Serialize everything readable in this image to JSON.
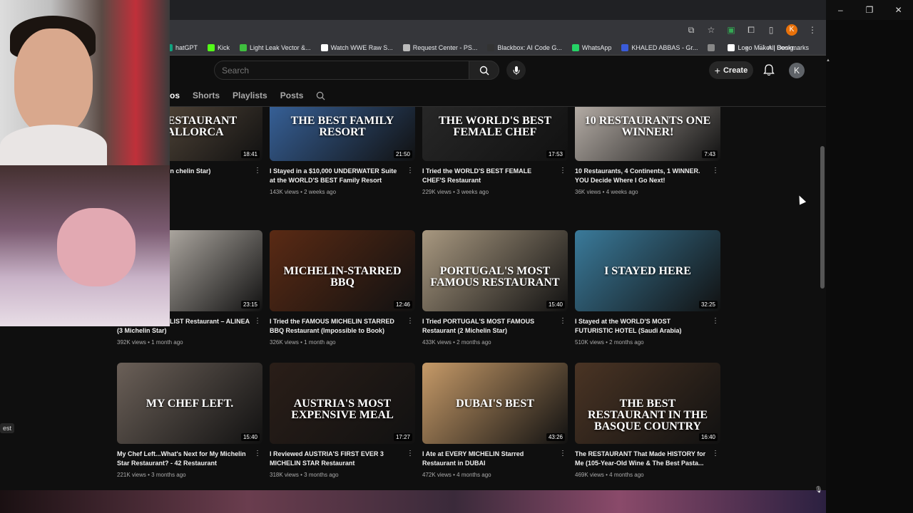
{
  "bookmarks": [
    {
      "label": "hatGPT",
      "color": "#10a37f"
    },
    {
      "label": "Kick",
      "color": "#53fc18"
    },
    {
      "label": "Light Leak Vector &...",
      "color": "#3fbf3f"
    },
    {
      "label": "Watch WWE Raw S...",
      "color": "#ffffff"
    },
    {
      "label": "Request Center - PS...",
      "color": "#bbbbbb"
    },
    {
      "label": "Blackbox: AI Code G...",
      "color": "#333333"
    },
    {
      "label": "WhatsApp",
      "color": "#25d366"
    },
    {
      "label": "KHALED ABBAS - Gr...",
      "color": "#3a5bd9"
    },
    {
      "label": "",
      "color": "#888888"
    },
    {
      "label": "Logo Maker | Desig...",
      "color": "#ffffff"
    }
  ],
  "bookmarks_more": "»",
  "all_bookmarks": "All Bookmarks",
  "profile_initial": "K",
  "search": {
    "placeholder": "Search"
  },
  "header": {
    "create_label": "Create",
    "avatar_initial": "K"
  },
  "tabs": [
    "os",
    "Shorts",
    "Playlists",
    "Posts"
  ],
  "left_sidebar": {
    "partial_label": "est"
  },
  "videos": [
    {
      "thumb_text": "ST RESTAURANT\nMALLORCA",
      "thumb_color": "#6b5a48",
      "duration": "18:41",
      "title": "T RESTAURANT in\nchelin Star)",
      "meta": "go"
    },
    {
      "thumb_text": "THE BEST FAMILY RESORT",
      "thumb_color": "#3b6aa8",
      "duration": "21:50",
      "title": "I Stayed in a $10,000 UNDERWATER Suite at the WORLD'S BEST Family Resort",
      "meta": "143K views • 2 weeks ago"
    },
    {
      "thumb_text": "THE WORLD'S BEST FEMALE CHEF",
      "thumb_color": "#2a2a2a",
      "duration": "17:53",
      "title": "I Tried the WORLD'S BEST FEMALE CHEF'S Restaurant",
      "meta": "229K views • 3 weeks ago"
    },
    {
      "thumb_text": "10 RESTAURANTS ONE WINNER!",
      "thumb_color": "#c9c0b8",
      "duration": "7:43",
      "title": "10 Restaurants, 4 Continents, 1 WINNER. YOU Decide Where I Go Next!",
      "meta": "36K views • 4 weeks ago"
    },
    {
      "thumb_text": "",
      "thumb_color": "#d8d1c8",
      "duration": "23:15",
      "title": "ICONIC BUCKET LIST Restaurant – ALINEA (3 Michelin Star)",
      "meta": "392K views • 1 month ago"
    },
    {
      "thumb_text": "MICHELIN-STARRED BBQ",
      "thumb_color": "#5a2a14",
      "duration": "12:46",
      "title": "I Tried the FAMOUS MICHELIN STARRED BBQ Restaurant (Impossible to Book)",
      "meta": "326K views • 1 month ago"
    },
    {
      "thumb_text": "PORTUGAL'S MOST FAMOUS RESTAURANT",
      "thumb_color": "#a89880",
      "duration": "15:40",
      "title": "I Tried PORTUGAL'S MOST FAMOUS Restaurant (2 Michelin Star)",
      "meta": "433K views • 2 months ago"
    },
    {
      "thumb_text": "I STAYED HERE",
      "thumb_color": "#3a7a9a",
      "duration": "32:25",
      "title": "I Stayed at the WORLD'S MOST FUTURISTIC HOTEL (Saudi Arabia)",
      "meta": "510K views • 2 months ago"
    },
    {
      "thumb_text": "MY CHEF LEFT.",
      "thumb_color": "#6b6058",
      "duration": "15:40",
      "title": "My Chef Left...What's Next for My Michelin Star Restaurant? - 42 Restaurant",
      "meta": "221K views • 3 months ago"
    },
    {
      "thumb_text": "AUSTRIA'S MOST EXPENSIVE MEAL",
      "thumb_color": "#2a1e18",
      "duration": "17:27",
      "title": "I Reviewed AUSTRIA'S FIRST EVER 3 MICHELIN STAR Restaurant",
      "meta": "318K views • 3 months ago"
    },
    {
      "thumb_text": "DUBAI'S BEST",
      "thumb_color": "#c69a68",
      "duration": "43:26",
      "title": "I Ate at EVERY MICHELIN Starred Restaurant in DUBAI",
      "meta": "472K views • 4 months ago"
    },
    {
      "thumb_text": "THE BEST RESTAURANT IN THE BASQUE COUNTRY",
      "thumb_color": "#4a3424",
      "duration": "16:40",
      "title": "The RESTAURANT That Made HISTORY for Me (105-Year-Old Wine & The Best Pasta...",
      "meta": "469K views • 4 months ago"
    }
  ]
}
